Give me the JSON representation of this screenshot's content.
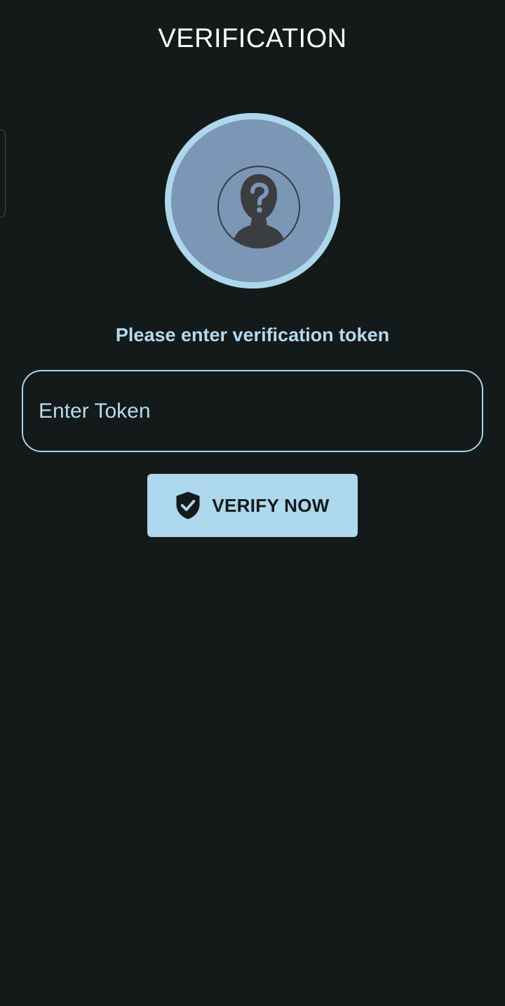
{
  "header": {
    "title": "VERIFICATION"
  },
  "avatar": {
    "icon": "unknown-user-icon",
    "ring_color": "#add7ec",
    "fill_color": "#7c96b6"
  },
  "form": {
    "prompt": "Please enter verification token",
    "token_input": {
      "value": "",
      "placeholder": "Enter Token"
    },
    "verify_button": {
      "label": "VERIFY NOW",
      "icon": "shield-check-icon"
    }
  },
  "colors": {
    "background": "#14191a",
    "accent": "#add8ed",
    "text_primary": "#ffffff"
  }
}
